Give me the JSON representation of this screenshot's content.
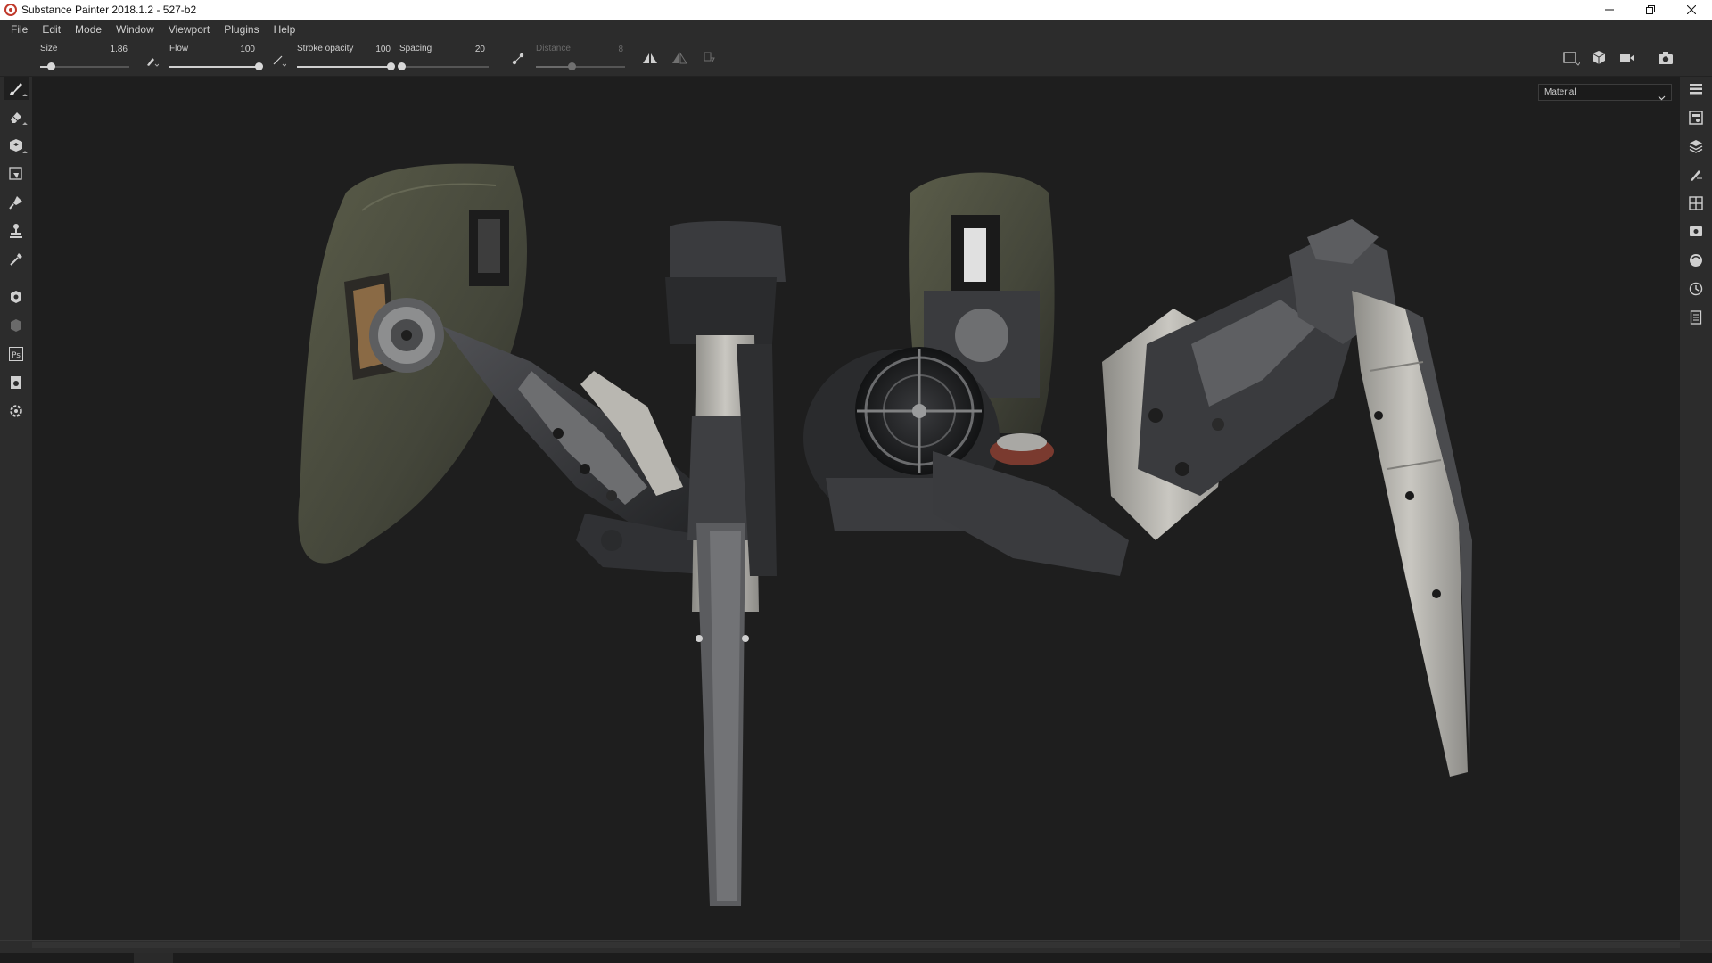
{
  "window": {
    "title": "Substance Painter 2018.1.2 - 527-b2",
    "icon": "substance-painter-logo-icon",
    "controls": [
      "minimize-icon",
      "restore-icon",
      "close-icon"
    ]
  },
  "menu": [
    "File",
    "Edit",
    "Mode",
    "Window",
    "Viewport",
    "Plugins",
    "Help"
  ],
  "tool_options": {
    "size": {
      "label": "Size",
      "value": "1.86",
      "level": 0.12
    },
    "flow": {
      "label": "Flow",
      "value": "100",
      "level": 1.0
    },
    "stroke_opacity": {
      "label": "Stroke opacity",
      "value": "100",
      "level": 1.0
    },
    "spacing": {
      "label": "Spacing",
      "value": "20",
      "level": 0.02
    },
    "distance": {
      "label": "Distance",
      "value": "8",
      "level": 0.4,
      "enabled": false
    },
    "icons": [
      "pressure-pen-icon",
      "stroke-line-icon",
      "lazy-mouse-icon",
      "symmetry-icon",
      "symmetry-mirror-icon",
      "rotation-icon"
    ],
    "view_icons": [
      "viewport-2d-icon",
      "viewport-3d-cube-icon",
      "camera-video-icon",
      "screenshot-camera-icon"
    ]
  },
  "left_tools": [
    "paint-brush-icon",
    "eraser-icon",
    "projection-icon",
    "polygon-fill-icon",
    "smudge-icon",
    "clone-stamp-icon",
    "color-picker-icon",
    "bake-mesh-maps-icon",
    "iray-render-icon",
    "photoshop-export-icon",
    "export-textures-icon",
    "settings-gear-icon"
  ],
  "right_dock": [
    "texture-set-list-icon",
    "texture-set-settings-icon",
    "layers-icon",
    "properties-brush-icon",
    "uv-grid-icon",
    "display-settings-icon",
    "shader-settings-sphere-icon",
    "history-clock-icon",
    "log-document-icon"
  ],
  "viewport": {
    "mode_label": "Material",
    "model": "mechanical-spider-robot-3d-model"
  },
  "colors": {
    "chrome": "#2c2c2c",
    "viewport_bg": "#1e1e1e",
    "text": "#cfcfcf",
    "shell_olive": "#4a4c3c",
    "metal_light": "#b5b3ad",
    "metal_dark": "#2e2f31"
  }
}
